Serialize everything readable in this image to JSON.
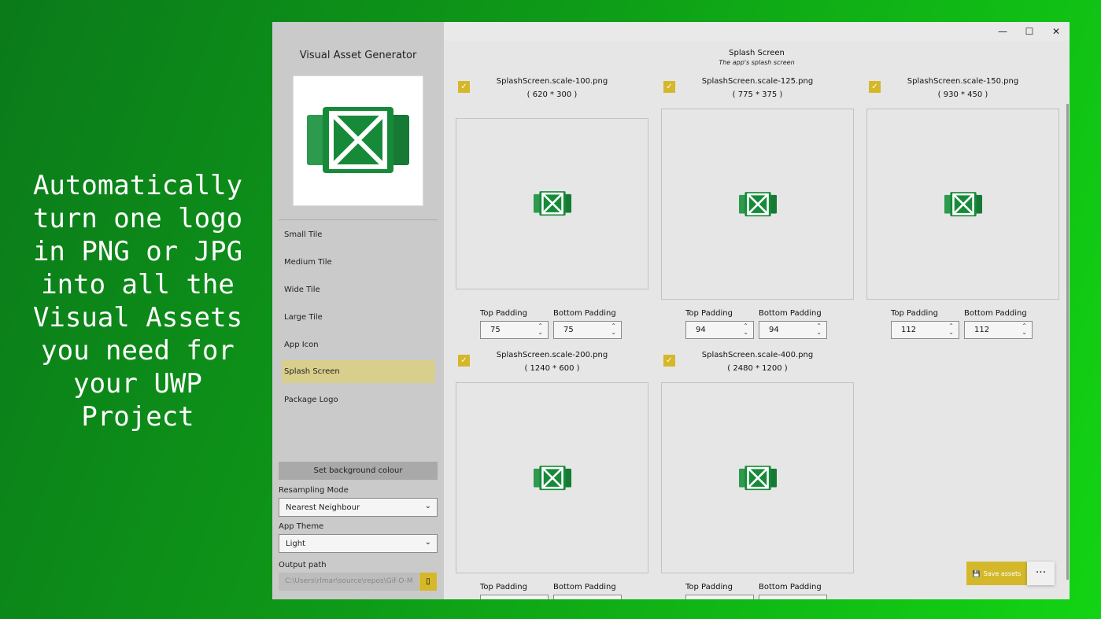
{
  "promo": {
    "text": "Automatically\nturn one logo\nin PNG or JPG\ninto all the\nVisual Assets\nyou need for\nyour UWP\nProject"
  },
  "window": {
    "minimize": "—",
    "maximize": "☐",
    "close": "✕"
  },
  "sidebar": {
    "title": "Visual Asset Generator",
    "items": [
      {
        "label": "Small Tile"
      },
      {
        "label": "Medium Tile"
      },
      {
        "label": "Wide Tile"
      },
      {
        "label": "Large Tile"
      },
      {
        "label": "App Icon"
      },
      {
        "label": "Splash Screen",
        "selected": true
      },
      {
        "label": "Package Logo"
      }
    ],
    "bg_button": "Set background colour",
    "resampling_label": "Resampling Mode",
    "resampling_value": "Nearest Neighbour",
    "theme_label": "App Theme",
    "theme_value": "Light",
    "output_label": "Output path",
    "output_value": "C:\\Users\\rlmar\\source\\repos\\Gif-O-M"
  },
  "page": {
    "title": "Splash Screen",
    "subtitle": "The app's splash screen"
  },
  "cards": [
    {
      "file": "SplashScreen.scale-100.png",
      "dims": "( 620 * 300 )",
      "top_label": "Top Padding",
      "bottom_label": "Bottom Padding",
      "top": "75",
      "bottom": "75"
    },
    {
      "file": "SplashScreen.scale-125.png",
      "dims": "( 775 * 375 )",
      "top_label": "Top Padding",
      "bottom_label": "Bottom Padding",
      "top": "94",
      "bottom": "94"
    },
    {
      "file": "SplashScreen.scale-150.png",
      "dims": "( 930 * 450 )",
      "top_label": "Top Padding",
      "bottom_label": "Bottom Padding",
      "top": "112",
      "bottom": "112"
    },
    {
      "file": "SplashScreen.scale-200.png",
      "dims": "( 1240 * 600 )",
      "top_label": "Top Padding",
      "bottom_label": "Bottom Padding"
    },
    {
      "file": "SplashScreen.scale-400.png",
      "dims": "( 2480 * 1200 )",
      "top_label": "Top Padding",
      "bottom_label": "Bottom Padding"
    }
  ],
  "actions": {
    "save": "Save assets",
    "more": "···"
  },
  "colors": {
    "accent": "#d4b82a",
    "logo_green": "#178a3a",
    "selected_nav": "#d9cf8c"
  }
}
